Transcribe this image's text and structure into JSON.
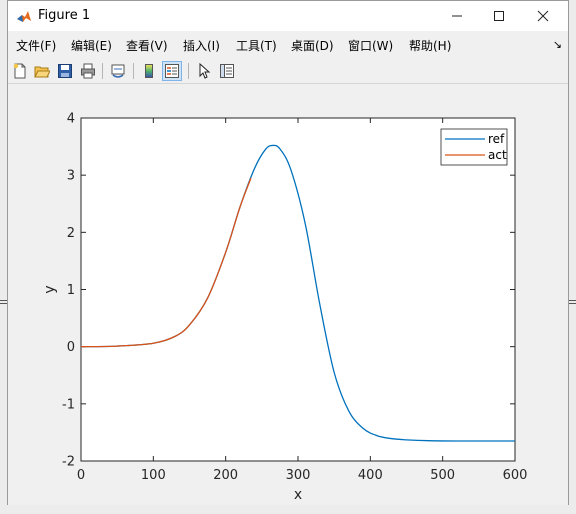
{
  "window": {
    "title": "Figure 1",
    "minimize": "—",
    "maximize": "☐",
    "close": "✕"
  },
  "menu": {
    "items": [
      {
        "label": "文件(F)"
      },
      {
        "label": "编辑(E)"
      },
      {
        "label": "查看(V)"
      },
      {
        "label": "插入(I)"
      },
      {
        "label": "工具(T)"
      },
      {
        "label": "桌面(D)"
      },
      {
        "label": "窗口(W)"
      },
      {
        "label": "帮助(H)"
      }
    ],
    "overflow": "↘"
  },
  "toolbar": {
    "icons": [
      "new-figure-icon",
      "open-file-icon",
      "save-icon",
      "print-icon",
      "link-plot-icon",
      "colorbar-icon",
      "legend-icon",
      "select-arrow-icon",
      "property-inspector-icon"
    ],
    "active": "legend-icon"
  },
  "chart_data": {
    "type": "line",
    "title": "",
    "xlabel": "x",
    "ylabel": "y",
    "xlim": [
      0,
      600
    ],
    "ylim": [
      -2,
      4
    ],
    "xticks": [
      "0",
      "100",
      "200",
      "300",
      "400",
      "500",
      "600"
    ],
    "yticks": [
      "-2",
      "-1",
      "0",
      "1",
      "2",
      "3",
      "4"
    ],
    "grid": false,
    "legend": {
      "position": "top-right",
      "entries": [
        "ref",
        "act"
      ]
    },
    "series": [
      {
        "name": "ref",
        "color": "#0072bd",
        "x": [
          0,
          50,
          100,
          130,
          150,
          175,
          200,
          220,
          240,
          255,
          265,
          275,
          290,
          310,
          330,
          350,
          370,
          390,
          410,
          430,
          450,
          480,
          520,
          560,
          600
        ],
        "y": [
          0.0,
          0.01,
          0.06,
          0.18,
          0.38,
          0.85,
          1.65,
          2.45,
          3.12,
          3.45,
          3.52,
          3.46,
          3.1,
          2.15,
          0.75,
          -0.45,
          -1.12,
          -1.43,
          -1.56,
          -1.61,
          -1.63,
          -1.645,
          -1.65,
          -1.65,
          -1.65
        ]
      },
      {
        "name": "act",
        "color": "#d95319",
        "x": [
          0,
          50,
          100,
          130,
          150,
          175,
          200,
          220,
          235
        ],
        "y": [
          0.0,
          0.01,
          0.06,
          0.18,
          0.38,
          0.85,
          1.65,
          2.45,
          2.95
        ]
      }
    ]
  }
}
